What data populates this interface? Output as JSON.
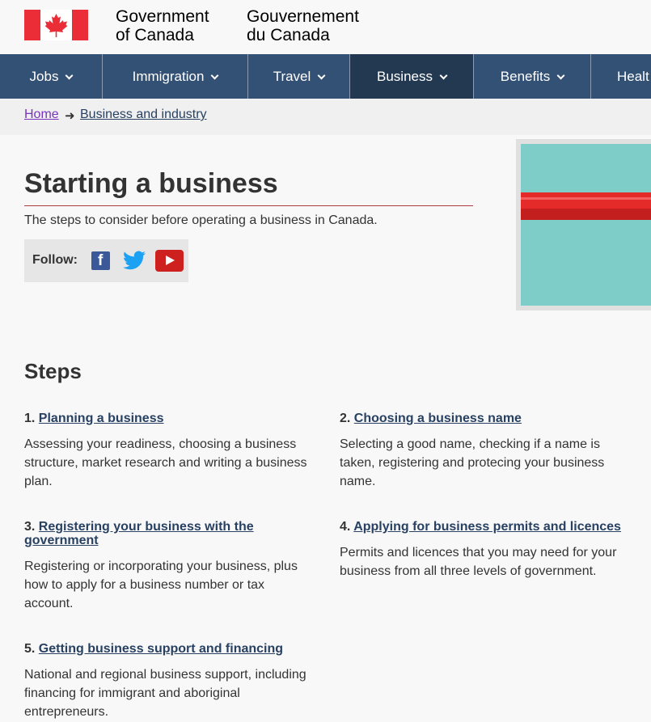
{
  "header": {
    "signature_en_line1": "Government",
    "signature_en_line2": "of Canada",
    "signature_fr_line1": "Gouvernement",
    "signature_fr_line2": "du Canada",
    "flag_icon": "canada-flag-icon"
  },
  "menu": {
    "items": [
      {
        "label": "Jobs"
      },
      {
        "label": "Immigration"
      },
      {
        "label": "Travel"
      },
      {
        "label": "Business",
        "active": true
      },
      {
        "label": "Benefits"
      },
      {
        "label": "Healt"
      }
    ]
  },
  "breadcrumb": {
    "home": "Home",
    "separator": "➜",
    "current": "Business and industry"
  },
  "page": {
    "title": "Starting a business",
    "lede": "The steps to consider before operating a business in Canada.",
    "follow_label": "Follow:"
  },
  "social": {
    "facebook_icon": "facebook-icon",
    "twitter_icon": "twitter-icon",
    "youtube_icon": "youtube-icon"
  },
  "steps": {
    "heading": "Steps",
    "items": [
      {
        "num": "1.",
        "link": "Planning a business",
        "desc": "Assessing your readiness, choosing a business structure, market research and writing a business plan."
      },
      {
        "num": "2.",
        "link": "Choosing a business name",
        "desc": "Selecting a good name, checking if a name is taken, registering and protecing your business name."
      },
      {
        "num": "3.",
        "link": "Registering your business with the government",
        "desc": "Registering or incorporating your business, plus how to apply for a business number or tax account."
      },
      {
        "num": "4.",
        "link": "Applying for business permits and licences",
        "desc": "Permits and licences that you may need for your business from all three levels of government."
      },
      {
        "num": "5.",
        "link": "Getting business support and financing",
        "desc": "National and regional business support, including financing for immigrant and aboriginal entrepreneurs."
      }
    ]
  },
  "colors": {
    "menu_bg": "#335075",
    "menu_active": "#233952",
    "link": "#284162",
    "visited_link": "#7834bc",
    "title_rule": "#af3c43"
  }
}
